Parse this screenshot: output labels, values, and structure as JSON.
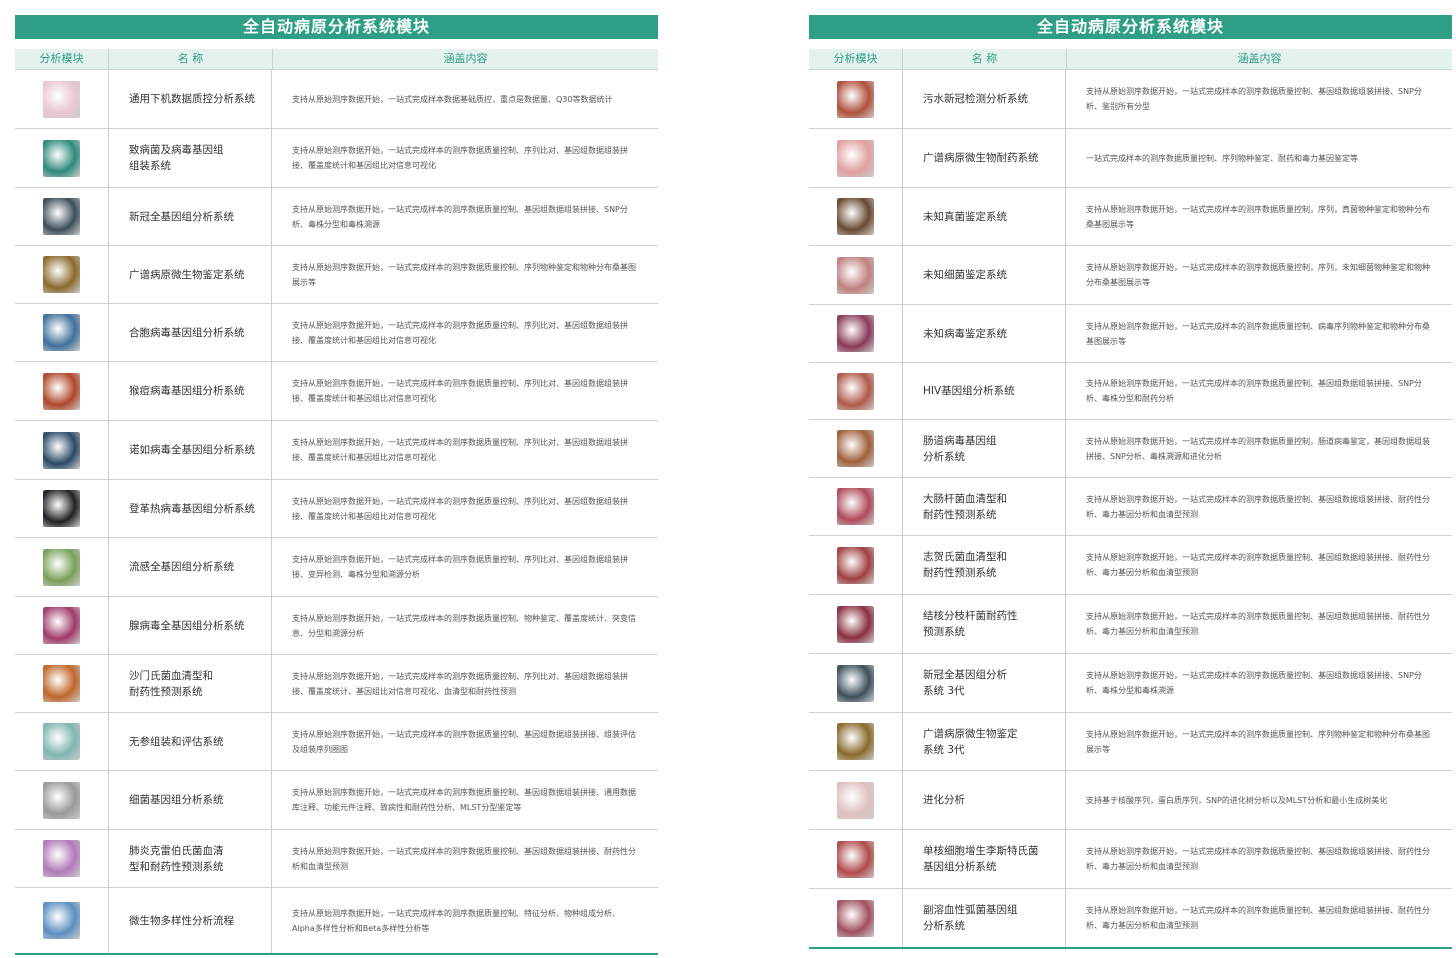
{
  "left": {
    "title": "全自动病原分析系统模块",
    "headers": [
      "分析模块",
      "名 称",
      "涵盖内容"
    ],
    "rows": [
      {
        "name": "通用下机数据质控分析系统",
        "desc": "支持从原始测序数据开始，一站式完成样本数据基础质控，重点是数据量、Q30等数据统计",
        "icon": "qc-chart-icon",
        "color": "#e9c7cf"
      },
      {
        "name": "致病菌及病毒基因组\n组装系统",
        "desc": "支持从原始测序数据开始，一站式完成样本的测序数据质量控制、序列比对、基因组数据组装拼接、覆盖度统计和基因组比对信息可视化",
        "icon": "bacteria-image-icon",
        "color": "#2f8a7c"
      },
      {
        "name": "新冠全基因组分析系统",
        "desc": "支持从原始测序数据开始，一站式完成样本的测序数据质量控制、基因组数据组装拼接、SNP分析、毒株分型和毒株溯源",
        "icon": "coronavirus-image-icon",
        "color": "#3d4f5a"
      },
      {
        "name": "广谱病原微生物鉴定系统",
        "desc": "支持从原始测序数据开始，一站式完成样本的测序数据质量控制、序列物种鉴定和物种分布桑基图展示等",
        "icon": "petri-dish-icon",
        "color": "#8a6a2c"
      },
      {
        "name": "合胞病毒基因组分析系统",
        "desc": "支持从原始测序数据开始，一站式完成样本的测序数据质量控制、序列比对、基因组数据组装拼接、覆盖度统计和基因组比对信息可视化",
        "icon": "rsv-image-icon",
        "color": "#3f6f9a"
      },
      {
        "name": "猴痘病毒基因组分析系统",
        "desc": "支持从原始测序数据开始，一站式完成样本的测序数据质量控制、序列比对、基因组数据组装拼接、覆盖度统计和基因组比对信息可视化",
        "icon": "monkeypox-image-icon",
        "color": "#b0472a"
      },
      {
        "name": "诺如病毒全基因组分析系统",
        "desc": "支持从原始测序数据开始，一站式完成样本的测序数据质量控制、序列比对、基因组数据组装拼接、覆盖度统计和基因组比对信息可视化",
        "icon": "norovirus-image-icon",
        "color": "#2a4a66"
      },
      {
        "name": "登革热病毒基因组分析系统",
        "desc": "支持从原始测序数据开始，一站式完成样本的测序数据质量控制、序列比对、基因组数据组装拼接、覆盖度统计和基因组比对信息可视化",
        "icon": "mosquito-image-icon",
        "color": "#1f2326"
      },
      {
        "name": "流感全基因组分析系统",
        "desc": "支持从原始测序数据开始，一站式完成样本的测序数据质量控制、序列比对、基因组数据组装拼接、变异检测、毒株分型和溯源分析",
        "icon": "influenza-image-icon",
        "color": "#7aa05a"
      },
      {
        "name": "腺病毒全基因组分析系统",
        "desc": "支持从原始测序数据开始，一站式完成样本的测序数据质量控制、物种鉴定、覆盖度统计、突变信息、分型和溯源分析",
        "icon": "adenovirus-image-icon",
        "color": "#a03a6a"
      },
      {
        "name": "沙门氏菌血清型和\n耐药性预测系统",
        "desc": "支持从原始测序数据开始，一站式完成样本的测序数据质量控制、序列比对、基因组数据组装拼接、覆盖度统计、基因组比对信息可视化、血清型和耐药性预测",
        "icon": "salmonella-image-icon",
        "color": "#c0672a"
      },
      {
        "name": "无参组装和评估系统",
        "desc": "支持从原始测序数据开始，一站式完成样本的测序数据质量控制、基因组数据组装拼接、组装评估及组装序列圈图",
        "icon": "circle-plot-icon",
        "color": "#7fb5b0"
      },
      {
        "name": "细菌基因组分析系统",
        "desc": "支持从原始测序数据开始，一站式完成样本的测序数据质量控制、基因组数据组装拼接、通用数据库注释、功能元件注释、致病性和耐药性分析、MLST分型鉴定等",
        "icon": "genome-circle-icon",
        "color": "#999999"
      },
      {
        "name": "肺炎克雷伯氏菌血清\n型和耐药性预测系统",
        "desc": "支持从原始测序数据开始，一站式完成样本的测序数据质量控制、基因组数据组装拼接、耐药性分析和血清型预测",
        "icon": "klebsiella-image-icon",
        "color": "#b07ab8"
      },
      {
        "name": "微生物多样性分析流程",
        "desc": "支持从原始测序数据开始，一站式完成样本的测序数据质量控制、特征分析、物种组成分析、Alpha多样性分析和Beta多样性分析等",
        "icon": "stacked-bar-icon",
        "color": "#5a8fc0"
      }
    ]
  },
  "right": {
    "title": "全自动病原分析系统模块",
    "headers": [
      "分析模块",
      "名 称",
      "涵盖内容"
    ],
    "rows": [
      {
        "name": "污水新冠检测分析系统",
        "desc": "支持从原始测序数据开始，一站式完成样本的测序数据质量控制、基因组数据组装拼接、SNP分析、鉴别所有分型",
        "icon": "sewage-virus-image-icon",
        "color": "#b0503a"
      },
      {
        "name": "广谱病原微生物耐药系统",
        "desc": "一站式完成样本的测序数据质量控制、序列物种鉴定、耐药和毒力基因鉴定等",
        "icon": "resistance-chart-icon",
        "color": "#e0a0a0"
      },
      {
        "name": "未知真菌鉴定系统",
        "desc": "支持从原始测序数据开始，一站式完成样本的测序数据质量控制，序列，真菌物种鉴定和物种分布桑基图展示等",
        "icon": "fungus-image-icon",
        "color": "#6a4a32"
      },
      {
        "name": "未知细菌鉴定系统",
        "desc": "支持从原始测序数据开始，一站式完成样本的测序数据质量控制，序列，未知细菌物种鉴定和物种分布桑基图展示等",
        "icon": "bacteria-rod-image-icon",
        "color": "#c08080"
      },
      {
        "name": "未知病毒鉴定系统",
        "desc": "支持从原始测序数据开始，一站式完成样本的测序数据质量控制、病毒序列物种鉴定和物种分布桑基图展示等",
        "icon": "virus-cluster-image-icon",
        "color": "#8a3a5a"
      },
      {
        "name": "HIV基因组分析系统",
        "desc": "支持从原始测序数据开始，一站式完成样本的测序数据质量控制、基因组数据组装拼接、SNP分析、毒株分型和耐药分析",
        "icon": "hiv-image-icon",
        "color": "#b05a4a"
      },
      {
        "name": "肠道病毒基因组\n分析系统",
        "desc": "支持从原始测序数据开始，一站式完成样本的测序数据质量控制，肠道病毒鉴定，基因组数据组装拼接、SNP分析、毒株溯源和进化分析",
        "icon": "enterovirus-image-icon",
        "color": "#a0603a"
      },
      {
        "name": "大肠杆菌血清型和\n耐药性预测系统",
        "desc": "支持从原始测序数据开始，一站式完成样本的测序数据质量控制、基因组数据组装拼接、耐药性分析、毒力基因分析和血清型预测",
        "icon": "ecoli-image-icon",
        "color": "#b04a5a"
      },
      {
        "name": "志贺氏菌血清型和\n耐药性预测系统",
        "desc": "支持从原始测序数据开始，一站式完成样本的测序数据质量控制、基因组数据组装拼接、耐药性分析、毒力基因分析和血清型预测",
        "icon": "shigella-image-icon",
        "color": "#a04040"
      },
      {
        "name": "结核分枝杆菌耐药性\n预测系统",
        "desc": "支持从原始测序数据开始，一站式完成样本的测序数据质量控制、基因组数据组装拼接、耐药性分析、毒力基因分析和血清型预测",
        "icon": "tuberculosis-image-icon",
        "color": "#8a3040"
      },
      {
        "name": "新冠全基因组分析\n系统 3代",
        "desc": "支持从原始测序数据开始，一站式完成样本的测序数据质量控制、基因组数据组装拼接、SNP分析、毒株分型和毒株溯源",
        "icon": "coronavirus-3g-image-icon",
        "color": "#3d4f5a"
      },
      {
        "name": "广谱病原微生物鉴定\n系统 3代",
        "desc": "支持从原始测序数据开始，一站式完成样本的测序数据质量控制、序列物种鉴定和物种分布桑基图展示等",
        "icon": "petri-dish-3g-icon",
        "color": "#8a6a2c"
      },
      {
        "name": "进化分析",
        "desc": "支持基于核酸序列，蛋白质序列，SNP的进化树分析以及MLST分析和最小生成树美化",
        "icon": "phylo-tree-icon",
        "color": "#e0c0c0"
      },
      {
        "name": "单核细胞增生李斯特氏菌\n基因组分析系统",
        "desc": "支持从原始测序数据开始，一站式完成样本的测序数据质量控制、基因组数据组装拼接、耐药性分析、毒力基因分析和血清型预测",
        "icon": "listeria-image-icon",
        "color": "#b04a4a"
      },
      {
        "name": "副溶血性弧菌基因组\n分析系统",
        "desc": "支持从原始测序数据开始，一站式完成样本的测序数据质量控制、基因组数据组装拼接、耐药性分析、毒力基因分析和血清型预测",
        "icon": "vibrio-image-icon",
        "color": "#a05060"
      }
    ]
  }
}
